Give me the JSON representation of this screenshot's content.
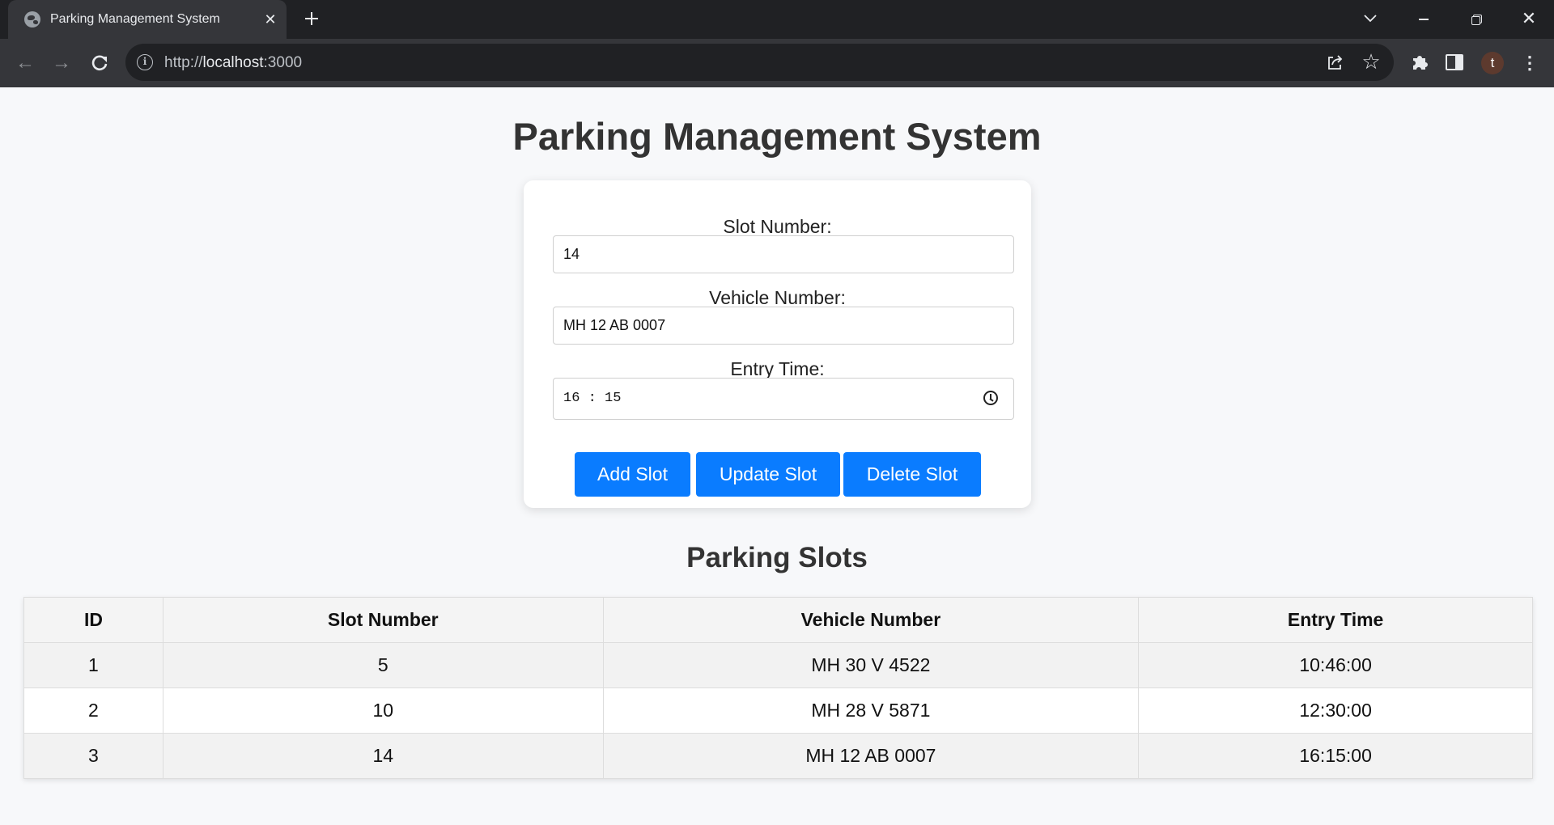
{
  "browser": {
    "tab_title": "Parking Management System",
    "url_scheme": "http://",
    "url_host": "localhost",
    "url_port": ":3000",
    "avatar_letter": "t"
  },
  "page": {
    "title": "Parking Management System",
    "form": {
      "slot_label": "Slot Number:",
      "slot_value": "14",
      "vehicle_label": "Vehicle Number:",
      "vehicle_value": "MH 12 AB 0007",
      "time_label": "Entry Time:",
      "time_value": "16:15",
      "add_label": "Add Slot",
      "update_label": "Update Slot",
      "delete_label": "Delete Slot"
    },
    "section_title": "Parking Slots",
    "table": {
      "headers": [
        "ID",
        "Slot Number",
        "Vehicle Number",
        "Entry Time"
      ],
      "rows": [
        [
          "1",
          "5",
          "MH 30 V 4522",
          "10:46:00"
        ],
        [
          "2",
          "10",
          "MH 28 V 5871",
          "12:30:00"
        ],
        [
          "3",
          "14",
          "MH 12 AB 0007",
          "16:15:00"
        ]
      ]
    }
  },
  "colors": {
    "accent": "#0a7cff",
    "chrome_dark": "#202124",
    "chrome_mid": "#35363a"
  },
  "icons": [
    "globe-icon",
    "close-icon",
    "plus-icon",
    "chevron-down-icon",
    "minimize-icon",
    "restore-icon",
    "back-icon",
    "forward-icon",
    "reload-icon",
    "info-icon",
    "share-icon",
    "star-icon",
    "puzzle-icon",
    "side-panel-icon",
    "kebab-menu-icon",
    "clock-icon"
  ]
}
